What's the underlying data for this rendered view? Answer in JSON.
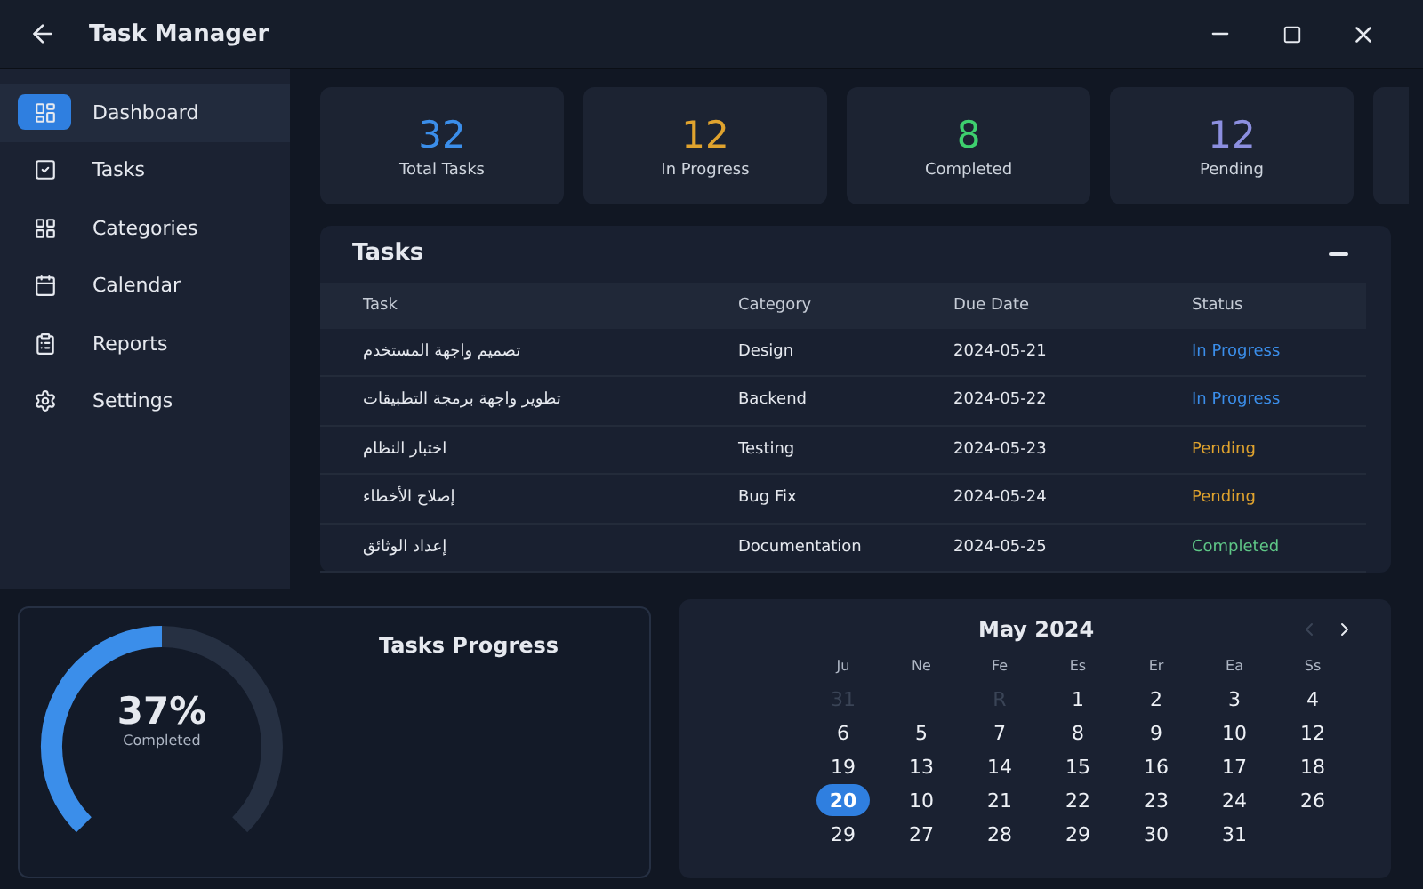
{
  "window": {
    "title": "Task Manager"
  },
  "sidebar": {
    "items": [
      {
        "label": "Dashboard",
        "kind": "dashboard",
        "selected": true
      },
      {
        "label": "Tasks",
        "kind": "tasks",
        "selected": false
      },
      {
        "label": "Categories",
        "kind": "categories",
        "selected": false
      },
      {
        "label": "Calendar",
        "kind": "calendar",
        "selected": false
      },
      {
        "label": "Reports",
        "kind": "reports",
        "selected": false
      },
      {
        "label": "Settings",
        "kind": "settings",
        "selected": false
      }
    ]
  },
  "stats": [
    {
      "value": "32",
      "label": "Total Tasks",
      "color": "#3b8eea"
    },
    {
      "value": "12",
      "label": "In Progress",
      "color": "#e0a32e"
    },
    {
      "value": "8",
      "label": "Completed",
      "color": "#3ecf6e"
    },
    {
      "value": "12",
      "label": "Pending",
      "color": "#8c8fe0"
    }
  ],
  "tasks": {
    "title": "Tasks",
    "columns": [
      "Task",
      "Category",
      "Due Date",
      "Status"
    ],
    "rows": [
      {
        "task": "تصميم واجهة المستخدم",
        "category": "Design",
        "due": "2024-05-21",
        "status": "In Progress",
        "kind": "progress"
      },
      {
        "task": "تطوير واجهة برمجة التطبيقات",
        "category": "Backend",
        "due": "2024-05-22",
        "status": "In Progress",
        "kind": "progress"
      },
      {
        "task": "اختبار النظام",
        "category": "Testing",
        "due": "2024-05-23",
        "status": "Pending",
        "kind": "pending"
      },
      {
        "task": "إصلاح الأخطاء",
        "category": "Bug Fix",
        "due": "2024-05-24",
        "status": "Pending",
        "kind": "pending"
      },
      {
        "task": "إعداد الوثائق",
        "category": "Documentation",
        "due": "2024-05-25",
        "status": "Completed",
        "kind": "completed"
      }
    ]
  },
  "progress": {
    "title": "Tasks Progress",
    "percent": "37%",
    "caption": "Completed",
    "level": 0.5
  },
  "calendar": {
    "month": "May 2024",
    "weekdays": [
      "Ju",
      "Ne",
      "Fe",
      "Es",
      "Er",
      "Ea",
      "Ss"
    ],
    "weeks": [
      [
        {
          "text": "31",
          "kind": "outside",
          "selected": false
        },
        {
          "kind": "blank"
        },
        {
          "text": "R",
          "kind": "outside",
          "selected": false
        },
        {
          "text": "1",
          "kind": "day",
          "selected": false
        },
        {
          "text": "2",
          "kind": "day",
          "selected": false
        },
        {
          "text": "3",
          "kind": "day",
          "selected": false
        },
        {
          "text": "4",
          "kind": "day",
          "selected": false
        }
      ],
      [
        {
          "text": "6",
          "kind": "day",
          "selected": false
        },
        {
          "text": "5",
          "kind": "day",
          "selected": false
        },
        {
          "text": "7",
          "kind": "day",
          "selected": false
        },
        {
          "text": "8",
          "kind": "day",
          "selected": false
        },
        {
          "text": "9",
          "kind": "day",
          "selected": false
        },
        {
          "text": "10",
          "kind": "day",
          "selected": false
        },
        {
          "text": "12",
          "kind": "day",
          "selected": false
        }
      ],
      [
        {
          "text": "19",
          "kind": "day",
          "selected": false
        },
        {
          "text": "13",
          "kind": "day",
          "selected": false
        },
        {
          "text": "14",
          "kind": "day",
          "selected": false
        },
        {
          "text": "15",
          "kind": "day",
          "selected": false
        },
        {
          "text": "16",
          "kind": "day",
          "selected": false
        },
        {
          "text": "17",
          "kind": "day",
          "selected": false
        },
        {
          "text": "18",
          "kind": "day",
          "selected": false
        }
      ],
      [
        {
          "text": "20",
          "kind": "day",
          "selected": true
        },
        {
          "text": "10",
          "kind": "day",
          "selected": false
        },
        {
          "text": "21",
          "kind": "day",
          "selected": false
        },
        {
          "text": "22",
          "kind": "day",
          "selected": false
        },
        {
          "text": "23",
          "kind": "day",
          "selected": false
        },
        {
          "text": "24",
          "kind": "day",
          "selected": false
        },
        {
          "text": "26",
          "kind": "day",
          "selected": false
        }
      ],
      [
        {
          "text": "29",
          "kind": "day",
          "selected": false
        },
        {
          "text": "27",
          "kind": "day",
          "selected": false
        },
        {
          "text": "28",
          "kind": "day",
          "selected": false
        },
        {
          "text": "29",
          "kind": "day",
          "selected": false
        },
        {
          "text": "30",
          "kind": "day",
          "selected": false
        },
        {
          "text": "31",
          "kind": "day",
          "selected": false
        }
      ]
    ]
  }
}
